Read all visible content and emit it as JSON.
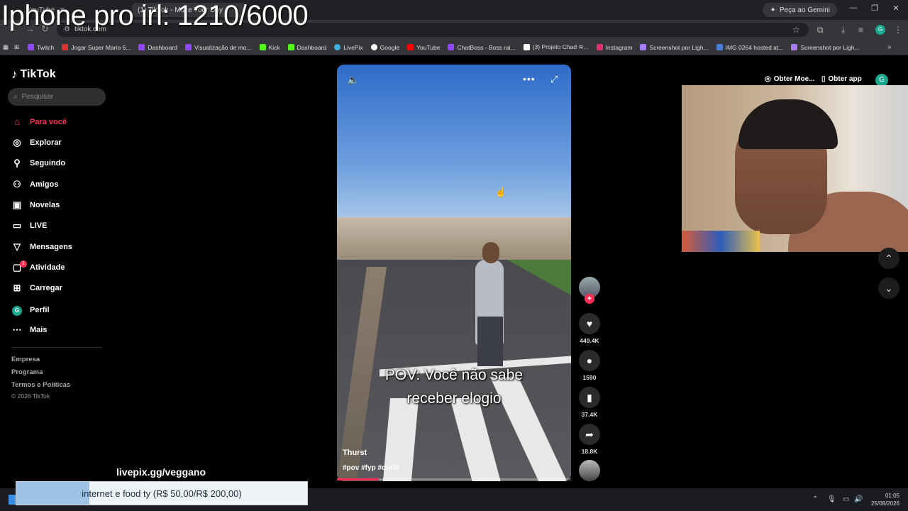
{
  "overlay": {
    "title": "Iphone pro irl: 1210/6000",
    "donation_link": "livepix.gg/veggano",
    "goal_text": "internet e food ty (R$ 50,00/R$ 200,00)",
    "goal_progress": 0.25
  },
  "browser": {
    "tabs": [
      {
        "label": "YouTube"
      },
      {
        "label": "(1) TikTok - Make Your Day"
      }
    ],
    "gemini_label": "Peça ao Gemini",
    "url": "tiktok.com",
    "bookmarks": [
      {
        "label": "Twitch",
        "color": "#9146ff"
      },
      {
        "label": "Jogar Super Mario 6...",
        "color": "#d33"
      },
      {
        "label": "Dashboard",
        "color": "#9146ff"
      },
      {
        "label": "Visualização de mo...",
        "color": "#9146ff"
      },
      {
        "label": "Kick",
        "color": "#53fc18"
      },
      {
        "label": "Dashboard",
        "color": "#53fc18"
      },
      {
        "label": "LivePix",
        "color": "#3ab0e6"
      },
      {
        "label": "Google",
        "color": "#ffffff"
      },
      {
        "label": "YouTube",
        "color": "#ff0000"
      },
      {
        "label": "ChatBoss - Boss rai...",
        "color": "#9146ff"
      },
      {
        "label": "(3) Projeto Chad ≋...",
        "color": "#ffffff"
      },
      {
        "label": "Instagram",
        "color": "#e1306c"
      },
      {
        "label": "Screenshot por Ligh...",
        "color": "#a77dff"
      },
      {
        "label": "IMG 0264 hosted at...",
        "color": "#4a7fd6"
      },
      {
        "label": "Screenshot por Ligh...",
        "color": "#a77dff"
      }
    ]
  },
  "tiktok": {
    "logo": "TikTok",
    "search_placeholder": "Pesquisar",
    "nav": [
      {
        "label": "Para você",
        "icon": "home-icon",
        "active": true
      },
      {
        "label": "Explorar",
        "icon": "compass-icon"
      },
      {
        "label": "Seguindo",
        "icon": "following-icon"
      },
      {
        "label": "Amigos",
        "icon": "friends-icon"
      },
      {
        "label": "Novelas",
        "icon": "novelas-icon"
      },
      {
        "label": "LIVE",
        "icon": "live-icon"
      },
      {
        "label": "Mensagens",
        "icon": "messages-icon"
      },
      {
        "label": "Atividade",
        "icon": "activity-icon"
      },
      {
        "label": "Carregar",
        "icon": "upload-icon"
      },
      {
        "label": "Perfil",
        "icon": "profile-icon"
      },
      {
        "label": "Mais",
        "icon": "more-icon"
      }
    ],
    "activity_badge": "1",
    "profile_initial": "G",
    "footer": [
      "Empresa",
      "Programa",
      "Termos e Políticas",
      "© 2026 TikTok"
    ],
    "top_right": {
      "coins": "Obter Moe...",
      "get_app": "Obter app",
      "profile_initial": "G"
    },
    "video": {
      "caption_line1": "POV: Você não sabe",
      "caption_line2": "receber elogio",
      "author": "Thurst",
      "tags": "#pov #fyp #outfit",
      "progress": 0.18
    },
    "actions": {
      "likes": "449.4K",
      "comments": "1590",
      "saves": "37.4K",
      "shares": "18.8K"
    }
  },
  "taskbar": {
    "time": "01:05",
    "date": "25/08/2026"
  },
  "colors": {
    "accent": "#fe2c55",
    "background": "#000000"
  }
}
